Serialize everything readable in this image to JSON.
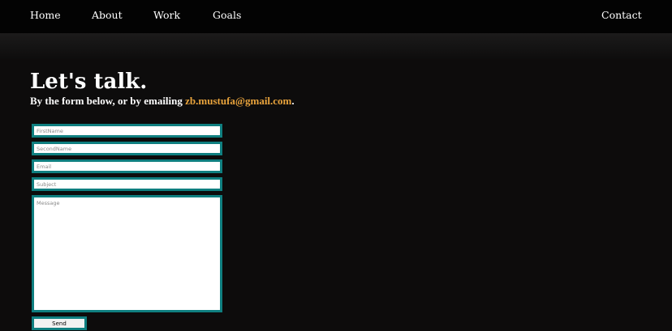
{
  "nav": {
    "home": "Home",
    "about": "About",
    "work": "Work",
    "goals": "Goals",
    "contact": "Contact"
  },
  "hero": {
    "heading": "Let's talk.",
    "subtitle_prefix": "By the form below, or by emailing ",
    "email": "zb.mustufa@gmail.com",
    "subtitle_suffix": "."
  },
  "form": {
    "first_name_placeholder": "FirstName",
    "first_name_value": "",
    "second_name_placeholder": "SecondName",
    "second_name_value": "",
    "email_placeholder": "Email",
    "email_value": "",
    "subject_placeholder": "Subject",
    "subject_value": "",
    "message_placeholder": "Message",
    "message_value": "",
    "send_label": "Send"
  },
  "colors": {
    "background": "#0d0c0c",
    "navbar": "#030303",
    "email_accent": "#e8a33c",
    "field_border": "#0f7f80"
  }
}
